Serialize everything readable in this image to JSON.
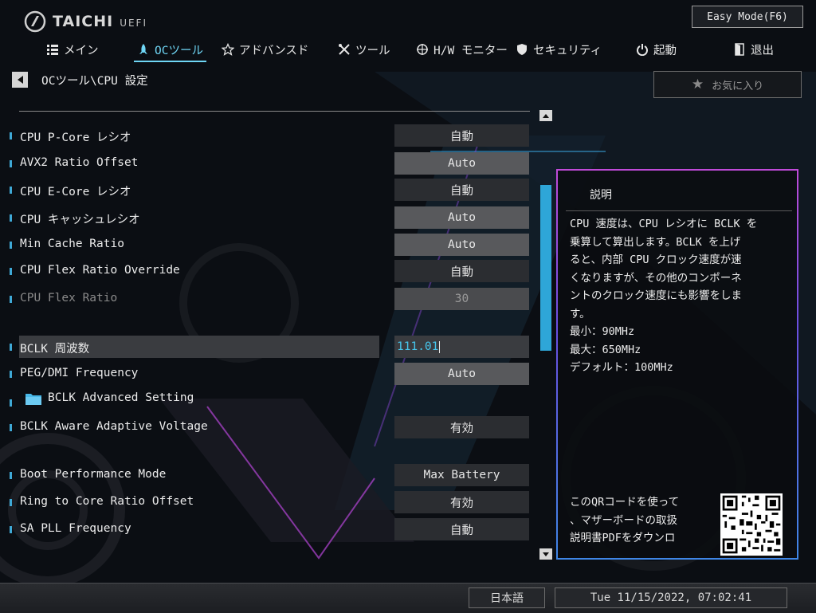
{
  "header": {
    "brand": "TAICHI",
    "brand_suffix": "UEFI",
    "easy_mode": "Easy Mode(F6)"
  },
  "nav": {
    "items": [
      {
        "label": "メイン",
        "icon": "list-icon"
      },
      {
        "label": "OCツール",
        "icon": "rocket-icon",
        "active": true
      },
      {
        "label": "アドバンスド",
        "icon": "star-outline-icon"
      },
      {
        "label": "ツール",
        "icon": "tools-icon"
      },
      {
        "label": "H/W モニター",
        "icon": "crosshair-icon"
      },
      {
        "label": "セキュリティ",
        "icon": "shield-icon"
      },
      {
        "label": "起動",
        "icon": "power-icon"
      },
      {
        "label": "退出",
        "icon": "exit-door-icon"
      }
    ]
  },
  "breadcrumb": "OCツール\\CPU 設定",
  "favorites": "お気に入り",
  "settings": [
    {
      "label": "CPU P-Core レシオ",
      "value": "自動"
    },
    {
      "label": "AVX2 Ratio Offset",
      "value": "Auto"
    },
    {
      "label": "CPU E-Core レシオ",
      "value": "自動"
    },
    {
      "label": "CPU  キャッシュレシオ",
      "value": "Auto"
    },
    {
      "label": "Min Cache  Ratio",
      "value": "Auto"
    },
    {
      "label": "CPU Flex   Ratio Override",
      "value": "自動"
    },
    {
      "label": "CPU Flex   Ratio",
      "value": "30"
    },
    {
      "label": "BCLK 周波数",
      "value": "111.01"
    },
    {
      "label": "PEG/DMI Frequency",
      "value": "Auto"
    },
    {
      "label": "BCLK Advanced Setting",
      "value": ""
    },
    {
      "label": "BCLK Aware Adaptive Voltage",
      "value": "有効"
    },
    {
      "label": "Boot Performance Mode",
      "value": "Max Battery"
    },
    {
      "label": "Ring to Core Ratio Offset",
      "value": "有効"
    },
    {
      "label": "SA PLL Frequency",
      "value": "自動"
    }
  ],
  "description": {
    "title": "説明",
    "lines": [
      "CPU 速度は、CPU レシオに BCLK を",
      "乗算して算出します。BCLK を上げ",
      "ると、内部 CPU クロック速度が速",
      "くなりますが、その他のコンポーネ",
      "ントのクロック速度にも影響をしま",
      "す。",
      "最小：90MHz",
      "最大：650MHz",
      "デフォルト：100MHz"
    ],
    "qr_lines": [
      "このQRコードを使って",
      "、マザーボードの取扱",
      "説明書PDFをダウンロ"
    ]
  },
  "footer": {
    "language": "日本語",
    "datetime": "Tue 11/15/2022, 07:02:41"
  },
  "colors": {
    "accent": "#6fd6f5",
    "scroll_thumb": "#2ea6d8",
    "input_text": "#46c6ec"
  }
}
